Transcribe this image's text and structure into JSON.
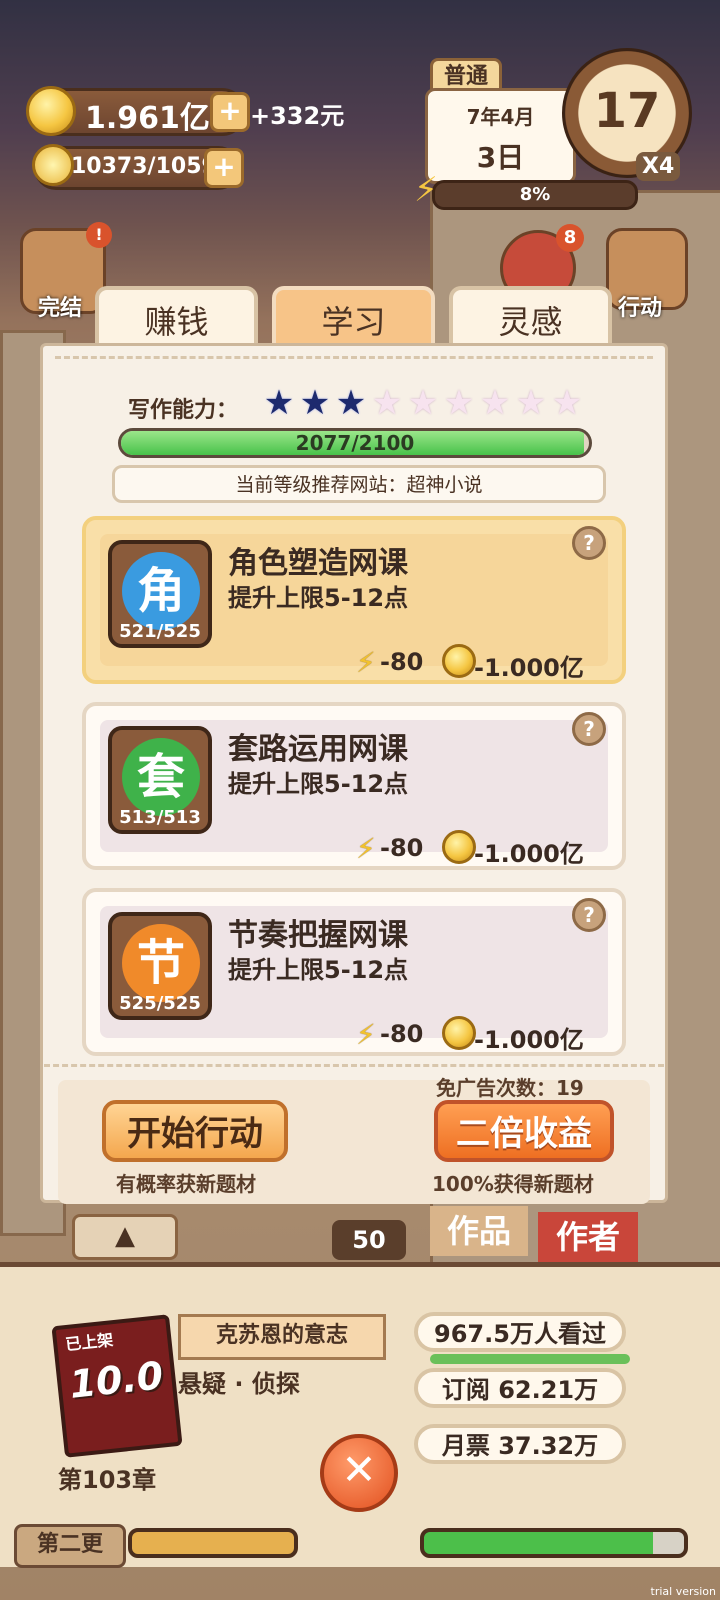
{
  "hud": {
    "money": "1.961亿",
    "money_income": "+332元",
    "energy": "10373/10599",
    "difficulty_tag": "普通",
    "date_line1": "7年4月",
    "date_line2": "3日",
    "progress_pct": "8%",
    "clock_day": "17",
    "speed": "X4",
    "badge_count": "8"
  },
  "side": {
    "left_label": "完结",
    "right_label": "行动"
  },
  "tabs": [
    {
      "label": "赚钱",
      "active": false
    },
    {
      "label": "学习",
      "active": true
    },
    {
      "label": "灵感",
      "active": false
    }
  ],
  "skill": {
    "label": "写作能力：",
    "stars_filled": 3,
    "stars_total": 9,
    "progress_text": "2077/2100",
    "progress_fraction": 0.989,
    "recommend": "当前等级推荐网站：超神小说"
  },
  "courses": [
    {
      "icon_char": "角",
      "icon_color": "#3a9be0",
      "count": "521/525",
      "title": "角色塑造网课",
      "desc": "提升上限5-12点",
      "energy_cost": "-80",
      "coin_cost": "-1.000亿",
      "selected": true
    },
    {
      "icon_char": "套",
      "icon_color": "#3fb24a",
      "count": "513/513",
      "title": "套路运用网课",
      "desc": "提升上限5-12点",
      "energy_cost": "-80",
      "coin_cost": "-1.000亿",
      "selected": false
    },
    {
      "icon_char": "节",
      "icon_color": "#f08a2a",
      "count": "525/525",
      "title": "节奏把握网课",
      "desc": "提升上限5-12点",
      "energy_cost": "-80",
      "coin_cost": "-1.000亿",
      "selected": false
    }
  ],
  "footer": {
    "ad_free": "免广告次数：19",
    "start_label": "开始行动",
    "start_sub": "有概率获新题材",
    "double_label": "二倍收益",
    "double_sub": "100%获得新题材"
  },
  "bottom": {
    "count_label": "50",
    "works_label": "作品",
    "author_label": "作者",
    "book_score": "10.0",
    "book_stamp": "已上架",
    "book_title": "克苏恩的意志",
    "book_genre": "悬疑 · 侦探",
    "chapter": "第103章",
    "views": "967.5万人看过",
    "subscriptions": "订阅 62.21万",
    "monthly_tickets": "月票 37.32万",
    "second_update": "第二更"
  },
  "watermark": "trial version"
}
